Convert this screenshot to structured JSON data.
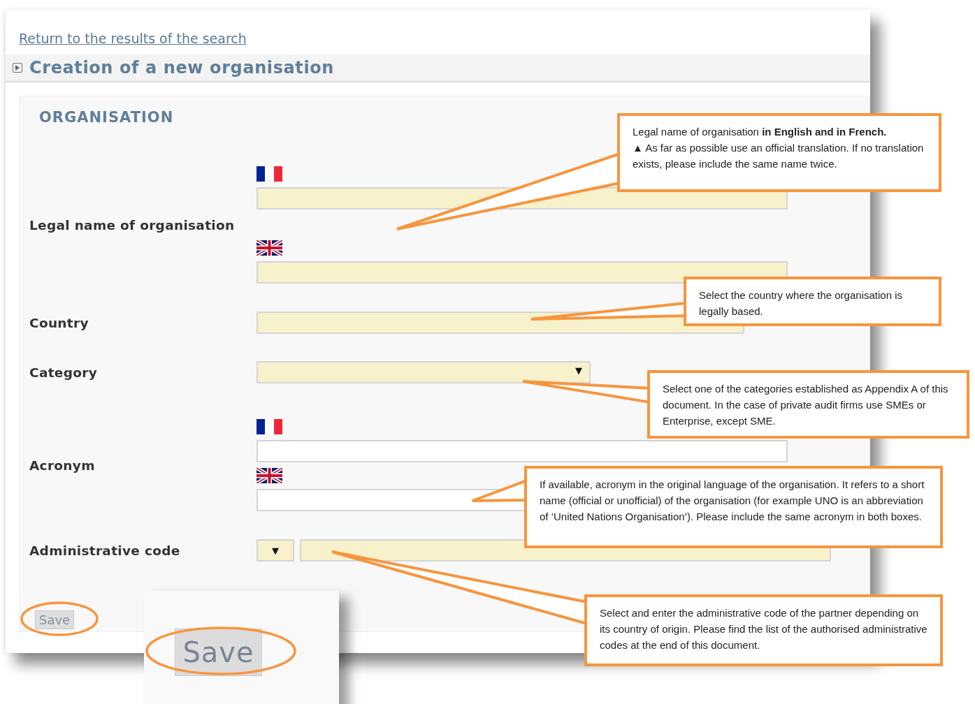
{
  "link": "Return to the results of the search",
  "section_title": "Creation of a new organisation",
  "panel_heading": "ORGANISATION",
  "fields": [
    {
      "kind": "bilingual",
      "label": "Legal name of organisation",
      "required": true,
      "inputs": [
        {
          "kind": "fr"
        },
        {
          "kind": "uk"
        }
      ]
    },
    {
      "kind": "select",
      "label": "Country",
      "required": true
    },
    {
      "kind": "select",
      "label": "Category",
      "required": true,
      "arrow": "▼"
    },
    {
      "kind": "bilingual",
      "label": "Acronym",
      "required": false,
      "inputs": [
        {
          "kind": "fr"
        },
        {
          "kind": "uk"
        }
      ]
    },
    {
      "kind": "code",
      "label": "Administrative code",
      "required": true,
      "arrow": "▼"
    }
  ],
  "save_button": "Save",
  "zoom_inset": {
    "save_button": "Save"
  },
  "callouts": [
    {
      "lines": [
        "Legal name of organisation **in English and in French.**",
        "▲ As far as possible use an official translation. If no translation exists, please include the same name twice."
      ]
    },
    {
      "lines": [
        "Select the country where the organisation is legally based."
      ]
    },
    {
      "lines": [
        "Select one of the categories established as Appendix A of this document. In the case of private audit firms use SMEs or Enterprise, except SME."
      ]
    },
    {
      "lines": [
        "If available, acronym in the original language of the organisation. It refers to a short name (official or unofficial) of the organisation (for example UNO is an abbreviation of ‘United Nations Organisation’). Please include the same acronym in both boxes."
      ]
    },
    {
      "lines": [
        "Select and enter the administrative code of the partner depending on its country of origin. Please find the list of the authorised administrative codes at the end of this document."
      ]
    }
  ]
}
